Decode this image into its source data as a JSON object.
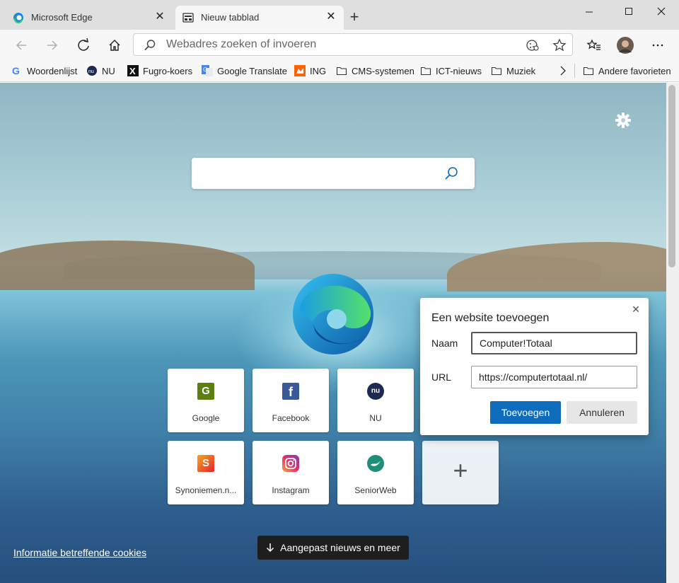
{
  "tabs": [
    {
      "label": "Microsoft Edge",
      "active": false
    },
    {
      "label": "Nieuw tabblad",
      "active": true
    }
  ],
  "address_bar": {
    "placeholder": "Webadres zoeken of invoeren"
  },
  "bookmarks": [
    "Woordenlijst",
    "NU",
    "Fugro-koers",
    "Google Translate",
    "ING",
    "CMS-systemen",
    "ICT-nieuws",
    "Muziek"
  ],
  "other_favorites": "Andere favorieten",
  "tiles": [
    {
      "name": "Google",
      "letter": "G"
    },
    {
      "name": "Facebook",
      "letter": "f"
    },
    {
      "name": "NU",
      "letter": "nu"
    },
    {
      "name": "Synoniemen.n...",
      "letter": "S"
    },
    {
      "name": "Instagram",
      "letter": ""
    },
    {
      "name": "SeniorWeb",
      "letter": ""
    }
  ],
  "add_tile": "+",
  "cookies_link": "Informatie betreffende cookies",
  "news_button": "Aangepast nieuws en meer",
  "dialog": {
    "title": "Een website toevoegen",
    "name_label": "Naam",
    "name_value": "Computer!Totaal",
    "url_label": "URL",
    "url_value": "https://computertotaal.nl/",
    "add_label": "Toevoegen",
    "cancel_label": "Annuleren"
  },
  "colors": {
    "accent": "#0f6cbd"
  }
}
